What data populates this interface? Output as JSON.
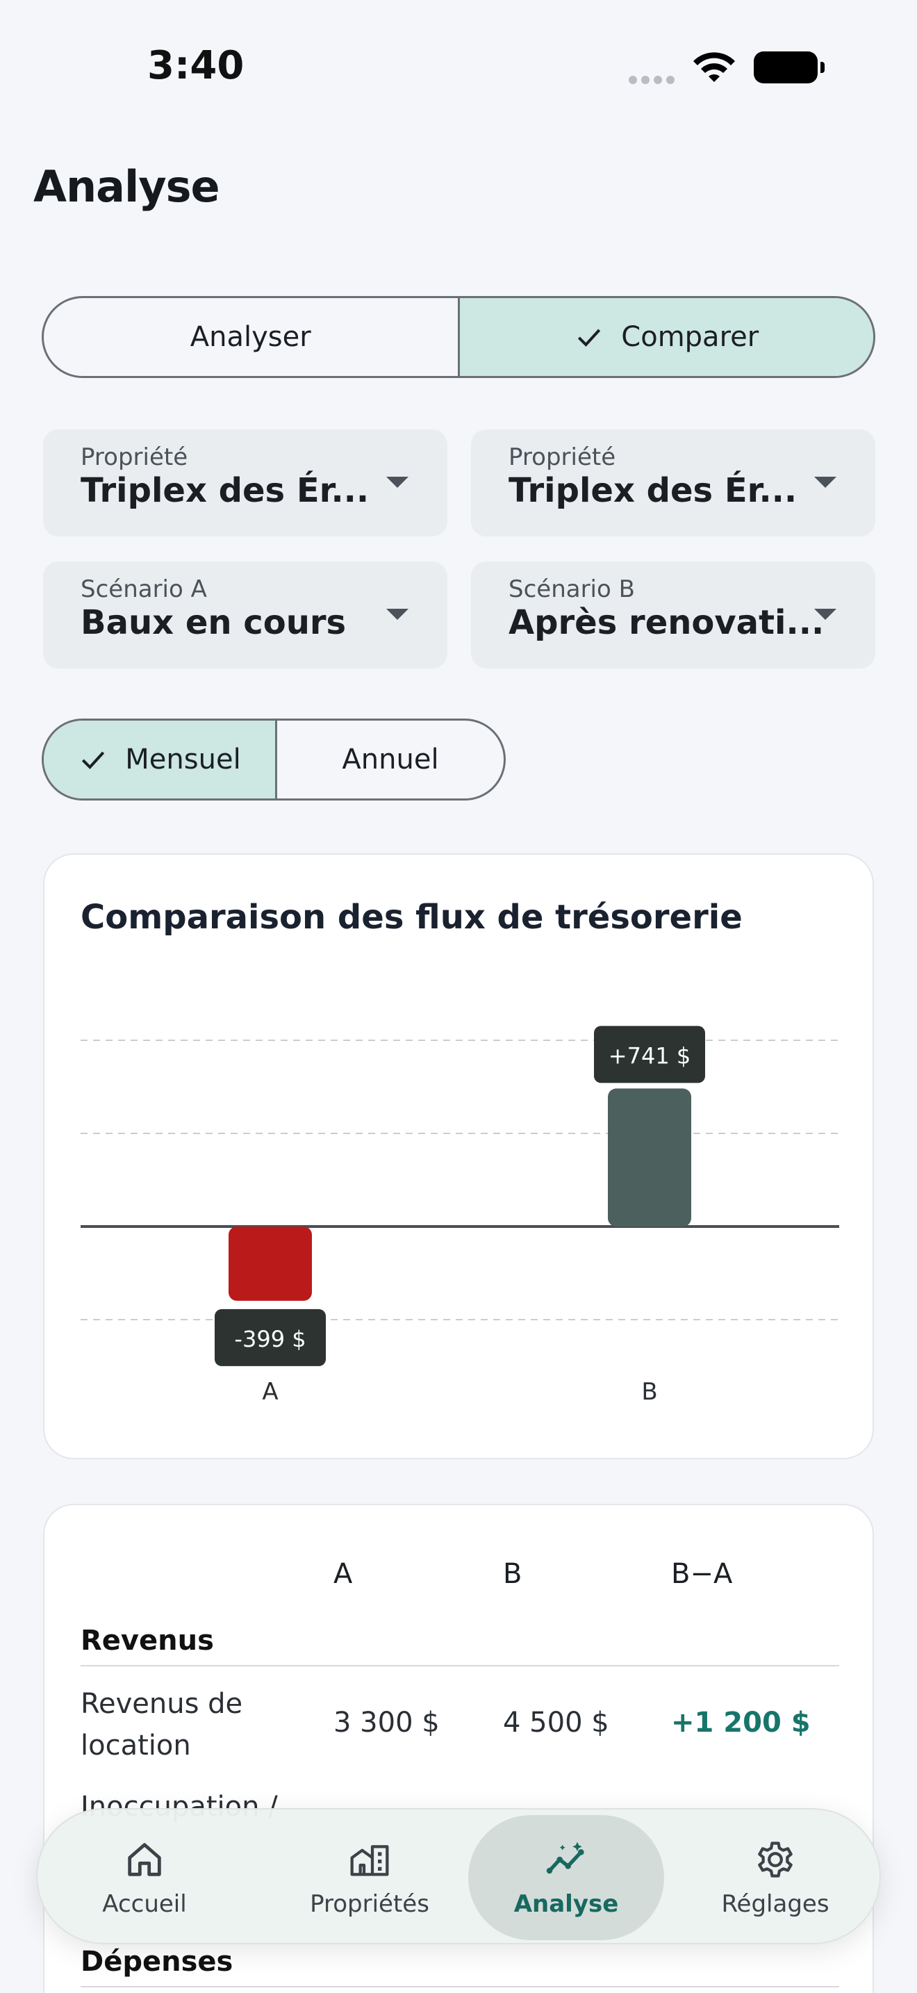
{
  "status": {
    "time": "3:40"
  },
  "page": {
    "title": "Analyse"
  },
  "mode_toggle": {
    "analyze": "Analyser",
    "compare": "Comparer",
    "selected": "Comparer"
  },
  "selectors": {
    "prop_a": {
      "label": "Propriété",
      "value": "Triplex des Ér..."
    },
    "prop_b": {
      "label": "Propriété",
      "value": "Triplex des Ér..."
    },
    "scen_a": {
      "label": "Scénario A",
      "value": "Baux en cours"
    },
    "scen_b": {
      "label": "Scénario B",
      "value": "Après renovati..."
    }
  },
  "period_toggle": {
    "monthly": "Mensuel",
    "yearly": "Annuel",
    "selected": "Mensuel"
  },
  "chart_data": {
    "type": "bar",
    "title": "Comparaison des flux de trésorerie",
    "categories": [
      "A",
      "B"
    ],
    "values": [
      -399,
      741
    ],
    "labels": [
      "-399 $",
      "+741 $"
    ],
    "colors": [
      "#bb1a1b",
      "#4c615d"
    ],
    "grid": true
  },
  "table": {
    "headers": [
      "A",
      "B",
      "B−A"
    ],
    "sections": [
      {
        "title": "Revenus",
        "rows": [
          {
            "label": "Revenus de location",
            "a": "3 300 $",
            "b": "4 500 $",
            "diff": "+1 200 $"
          }
        ]
      }
    ],
    "partial_row_label": "Inoccupation /",
    "next_section_title": "Dépenses"
  },
  "nav": {
    "items": [
      {
        "label": "Accueil",
        "icon": "home-icon"
      },
      {
        "label": "Propriétés",
        "icon": "buildings-icon"
      },
      {
        "label": "Analyse",
        "icon": "analytics-icon"
      },
      {
        "label": "Réglages",
        "icon": "gear-icon"
      }
    ],
    "active": "Analyse"
  }
}
